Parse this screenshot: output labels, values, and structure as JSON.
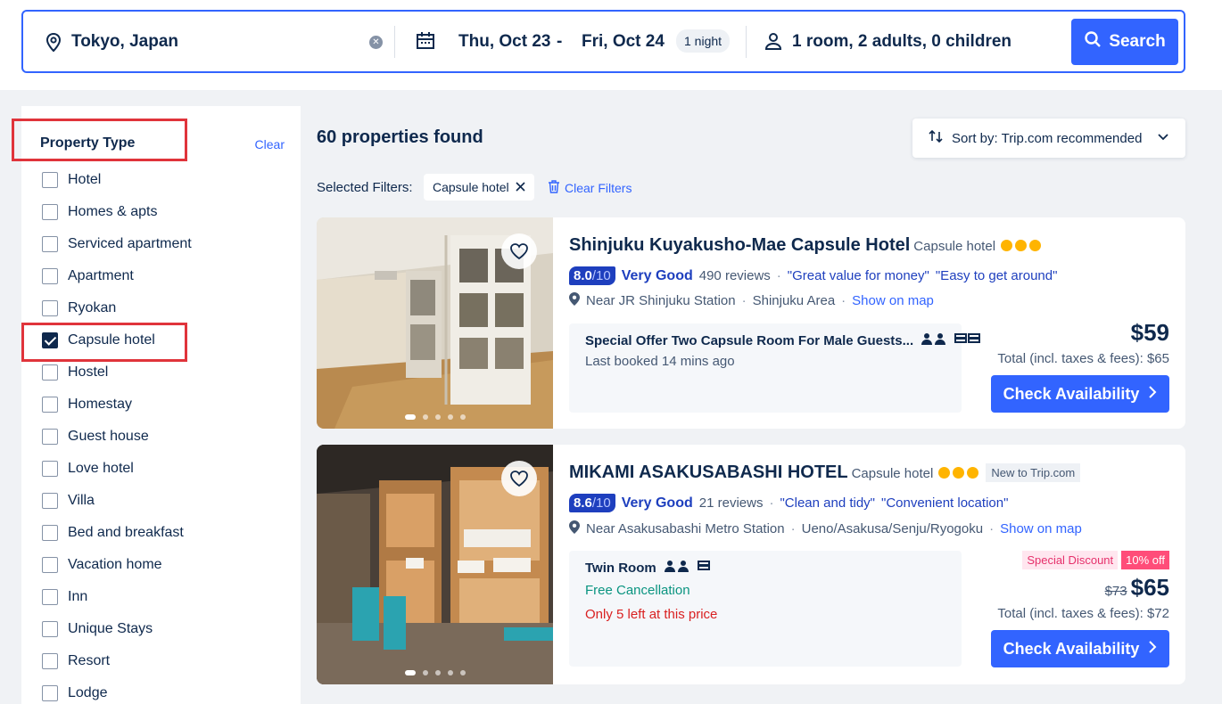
{
  "search": {
    "destination": "Tokyo, Japan",
    "checkin": "Thu, Oct 23",
    "dash": "-",
    "checkout": "Fri, Oct 24",
    "nights": "1 night",
    "guests": "1 room, 2 adults, 0 children",
    "search_label": "Search",
    "accent": "#3264ff"
  },
  "sidebar": {
    "title": "Property Type",
    "clear_label": "Clear",
    "items": [
      {
        "label": "Hotel",
        "checked": false
      },
      {
        "label": "Homes & apts",
        "checked": false
      },
      {
        "label": "Serviced apartment",
        "checked": false
      },
      {
        "label": "Apartment",
        "checked": false
      },
      {
        "label": "Ryokan",
        "checked": false
      },
      {
        "label": "Capsule hotel",
        "checked": true
      },
      {
        "label": "Hostel",
        "checked": false
      },
      {
        "label": "Homestay",
        "checked": false
      },
      {
        "label": "Guest house",
        "checked": false
      },
      {
        "label": "Love hotel",
        "checked": false
      },
      {
        "label": "Villa",
        "checked": false
      },
      {
        "label": "Bed and breakfast",
        "checked": false
      },
      {
        "label": "Vacation home",
        "checked": false
      },
      {
        "label": "Inn",
        "checked": false
      },
      {
        "label": "Unique Stays",
        "checked": false
      },
      {
        "label": "Resort",
        "checked": false
      },
      {
        "label": "Lodge",
        "checked": false
      }
    ]
  },
  "results": {
    "count_text": "60 properties found",
    "sort_label": "Sort by: Trip.com recommended",
    "selected_filters_label": "Selected Filters:",
    "filter_chip": "Capsule hotel",
    "clear_filters": "Clear Filters"
  },
  "hotels": [
    {
      "name": "Shinjuku Kuyakusho-Mae Capsule Hotel",
      "type": "Capsule hotel",
      "rating": "8.0",
      "rating_max": "/10",
      "rating_word": "Very Good",
      "reviews": "490 reviews",
      "tag1": "\"Great value for money\"",
      "tag2": "\"Easy to get around\"",
      "location": "Near JR Shinjuku Station",
      "area": "Shinjuku Area",
      "map_link": "Show on map",
      "room_name": "Special Offer Two Capsule Room For Male Guests...",
      "room_sub": "Last booked 14 mins ago",
      "price": "$59",
      "total": "Total (incl. taxes & fees): $65",
      "button": "Check Availability"
    },
    {
      "name": "MIKAMI ASAKUSABASHI HOTEL",
      "type": "Capsule hotel",
      "new_badge": "New to Trip.com",
      "rating": "8.6",
      "rating_max": "/10",
      "rating_word": "Very Good",
      "reviews": "21 reviews",
      "tag1": "\"Clean and tidy\"",
      "tag2": "\"Convenient location\"",
      "location": "Near Asakusabashi Metro Station",
      "area": "Ueno/Asakusa/Senju/Ryogoku",
      "map_link": "Show on map",
      "room_name": "Twin Room",
      "room_sub1": "Free Cancellation",
      "room_sub2": "Only 5 left at this price",
      "discount_label": "Special Discount",
      "discount_pct": "10% off",
      "old_price": "$73",
      "price": "$65",
      "total": "Total (incl. taxes & fees): $72",
      "button": "Check Availability"
    }
  ]
}
